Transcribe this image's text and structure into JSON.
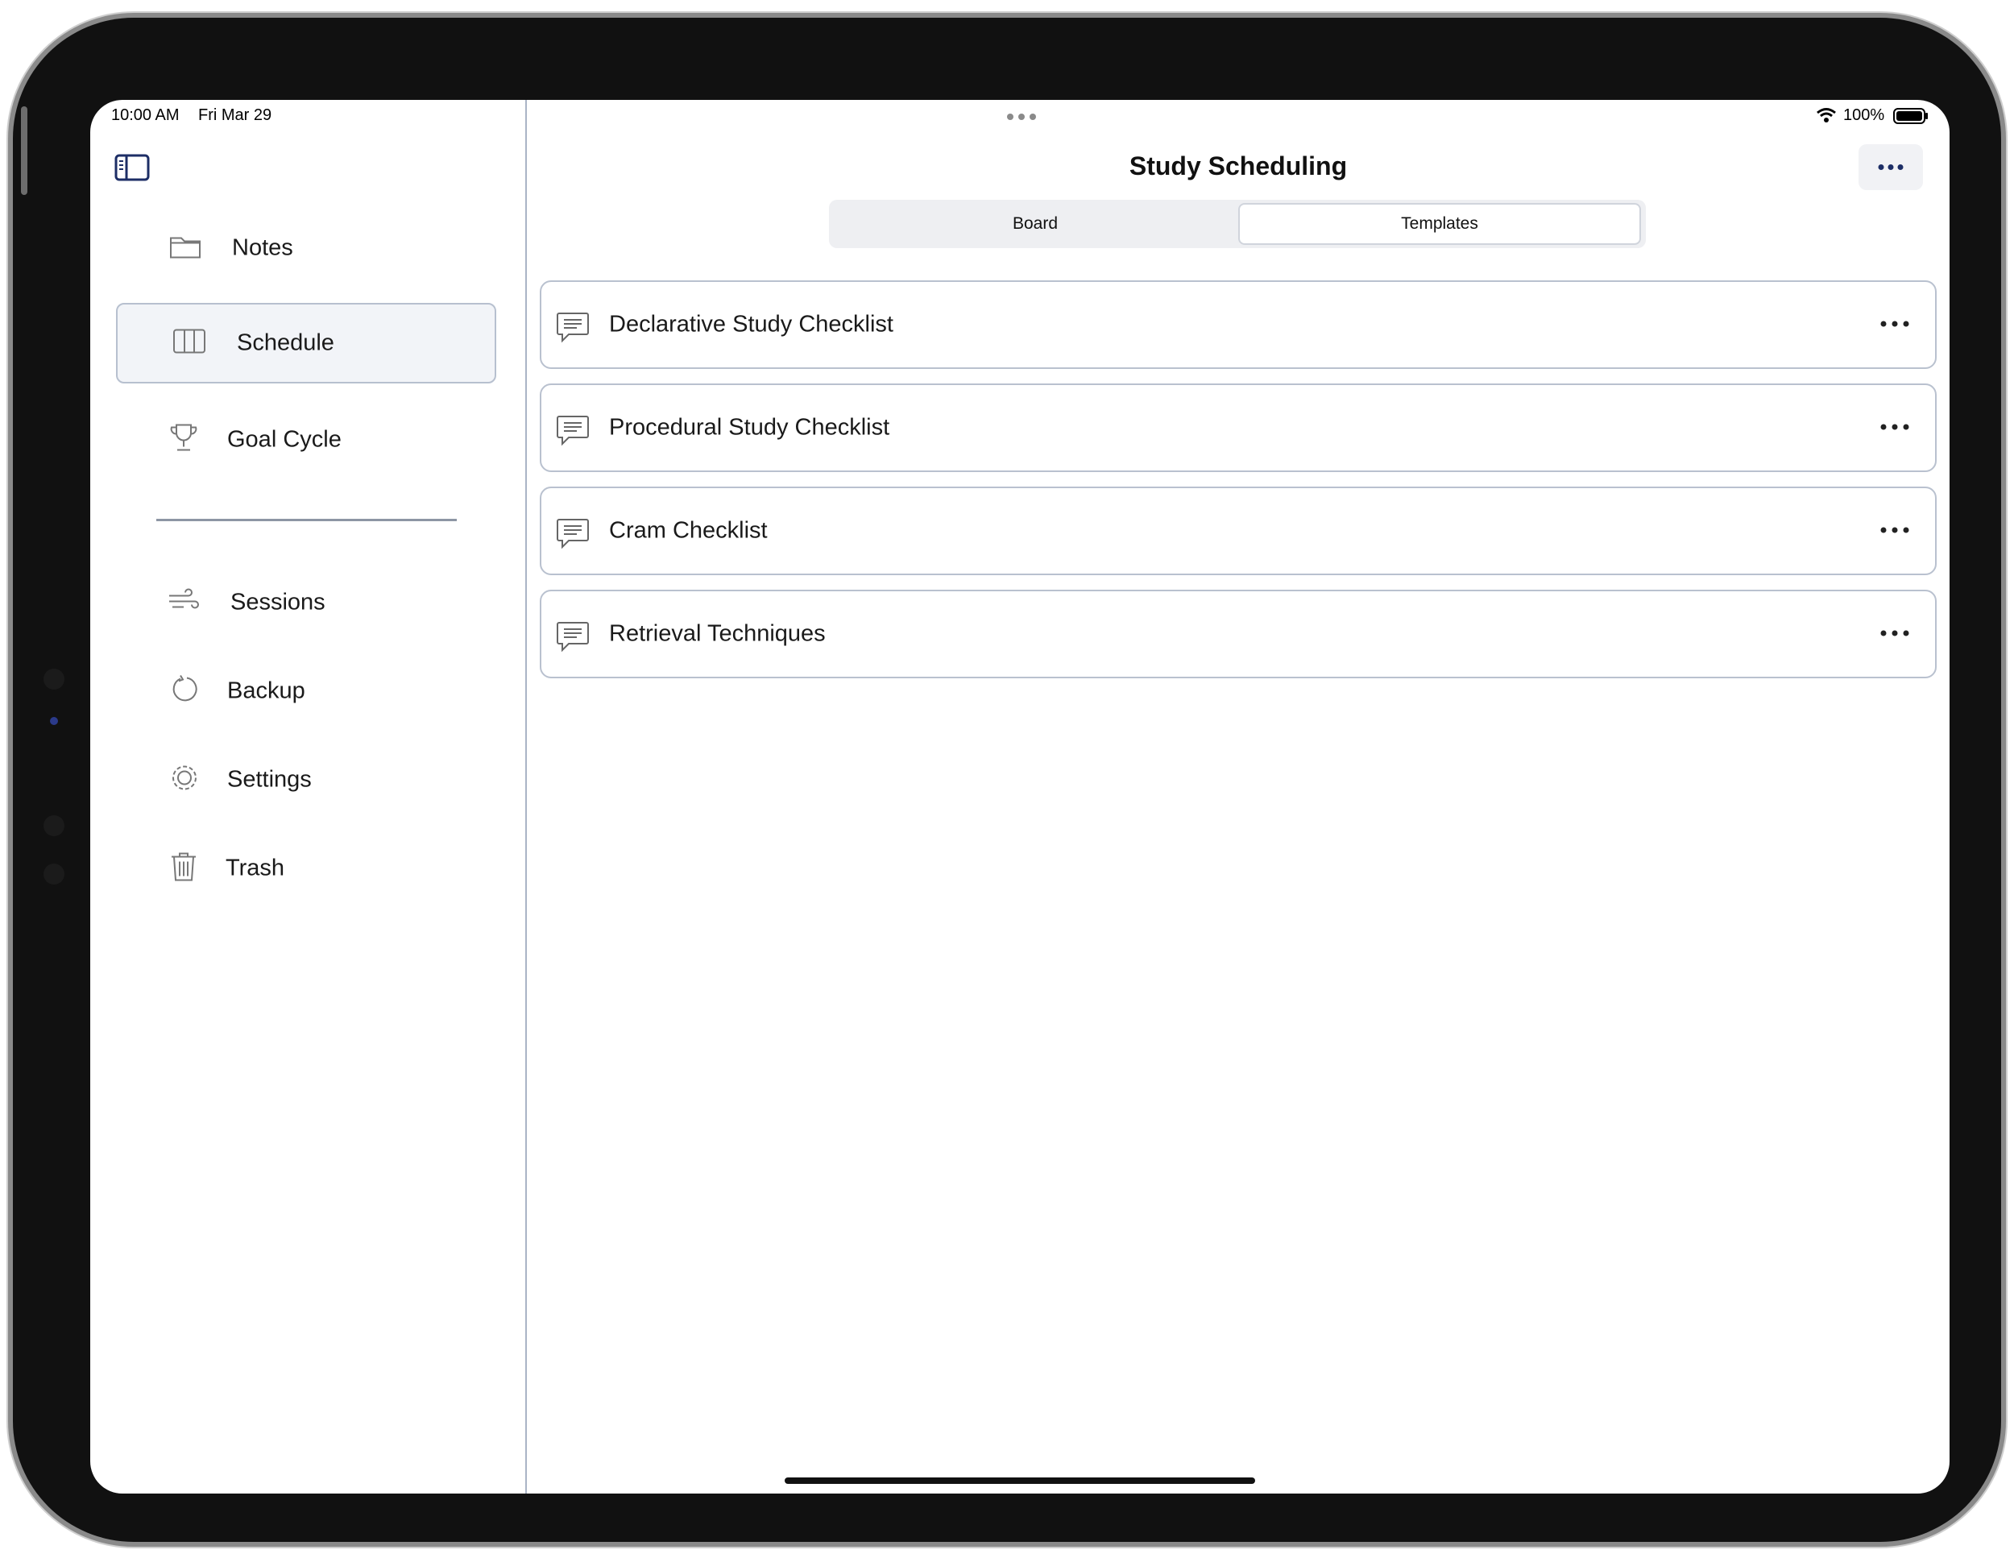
{
  "status_bar": {
    "time": "10:00 AM",
    "date": "Fri Mar 29",
    "battery": "100%"
  },
  "sidebar": {
    "items": [
      {
        "label": "Notes",
        "icon": "folder-icon",
        "selected": false
      },
      {
        "label": "Schedule",
        "icon": "columns-icon",
        "selected": true
      },
      {
        "label": "Goal Cycle",
        "icon": "trophy-icon",
        "selected": false
      },
      {
        "label": "Sessions",
        "icon": "wind-icon",
        "selected": false
      },
      {
        "label": "Backup",
        "icon": "backup-icon",
        "selected": false
      },
      {
        "label": "Settings",
        "icon": "gear-icon",
        "selected": false
      },
      {
        "label": "Trash",
        "icon": "trash-icon",
        "selected": false
      }
    ]
  },
  "main": {
    "title": "Study Scheduling",
    "segments": [
      {
        "label": "Board",
        "active": false
      },
      {
        "label": "Templates",
        "active": true
      }
    ],
    "templates": [
      {
        "label": "Declarative Study Checklist"
      },
      {
        "label": "Procedural Study Checklist"
      },
      {
        "label": "Cram Checklist"
      },
      {
        "label": "Retrieval Techniques"
      }
    ]
  },
  "colors": {
    "accent": "#1d2e66",
    "border": "#b9c1cf",
    "selected_bg": "#f2f4f8"
  }
}
